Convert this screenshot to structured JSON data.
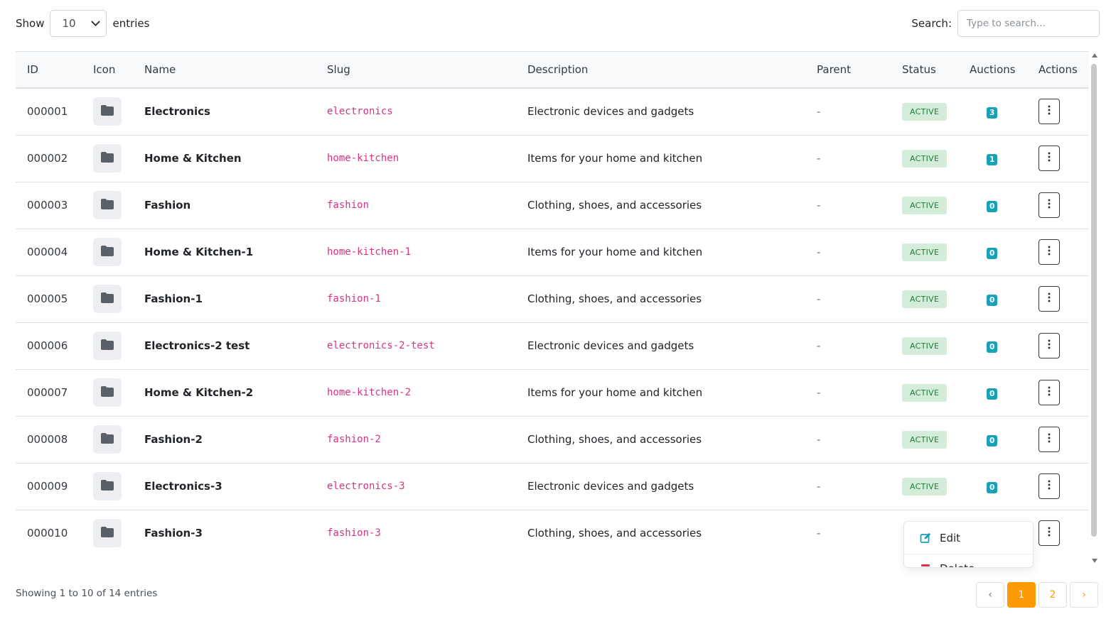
{
  "controls": {
    "show_label": "Show",
    "entries_value": "10",
    "entries_label": "entries",
    "search_label": "Search:",
    "search_placeholder": "Type to search...",
    "search_value": ""
  },
  "table": {
    "columns": [
      "ID",
      "Icon",
      "Name",
      "Slug",
      "Description",
      "Parent",
      "Status",
      "Auctions",
      "Actions"
    ],
    "rows": [
      {
        "id": "000001",
        "icon": "folder-icon",
        "name": "Electronics",
        "slug": "electronics",
        "description": "Electronic devices and gadgets",
        "parent": "-",
        "status": "ACTIVE",
        "auctions": "3"
      },
      {
        "id": "000002",
        "icon": "folder-icon",
        "name": "Home & Kitchen",
        "slug": "home-kitchen",
        "description": "Items for your home and kitchen",
        "parent": "-",
        "status": "ACTIVE",
        "auctions": "1"
      },
      {
        "id": "000003",
        "icon": "folder-icon",
        "name": "Fashion",
        "slug": "fashion",
        "description": "Clothing, shoes, and accessories",
        "parent": "-",
        "status": "ACTIVE",
        "auctions": "0"
      },
      {
        "id": "000004",
        "icon": "folder-icon",
        "name": "Home & Kitchen-1",
        "slug": "home-kitchen-1",
        "description": "Items for your home and kitchen",
        "parent": "-",
        "status": "ACTIVE",
        "auctions": "0"
      },
      {
        "id": "000005",
        "icon": "folder-icon",
        "name": "Fashion-1",
        "slug": "fashion-1",
        "description": "Clothing, shoes, and accessories",
        "parent": "-",
        "status": "ACTIVE",
        "auctions": "0"
      },
      {
        "id": "000006",
        "icon": "folder-icon",
        "name": "Electronics-2 test",
        "slug": "electronics-2-test",
        "description": "Electronic devices and gadgets",
        "parent": "-",
        "status": "ACTIVE",
        "auctions": "0"
      },
      {
        "id": "000007",
        "icon": "folder-icon",
        "name": "Home & Kitchen-2",
        "slug": "home-kitchen-2",
        "description": "Items for your home and kitchen",
        "parent": "-",
        "status": "ACTIVE",
        "auctions": "0"
      },
      {
        "id": "000008",
        "icon": "folder-icon",
        "name": "Fashion-2",
        "slug": "fashion-2",
        "description": "Clothing, shoes, and accessories",
        "parent": "-",
        "status": "ACTIVE",
        "auctions": "0"
      },
      {
        "id": "000009",
        "icon": "folder-icon",
        "name": "Electronics-3",
        "slug": "electronics-3",
        "description": "Electronic devices and gadgets",
        "parent": "-",
        "status": "ACTIVE",
        "auctions": "0"
      },
      {
        "id": "000010",
        "icon": "folder-icon",
        "name": "Fashion-3",
        "slug": "fashion-3",
        "description": "Clothing, shoes, and accessories",
        "parent": "-",
        "status": "",
        "auctions": ""
      }
    ]
  },
  "dropdown": {
    "edit_label": "Edit",
    "edit_icon": "edit-icon",
    "delete_label": "Delete",
    "delete_icon": "trash-icon"
  },
  "footer": {
    "info": "Showing 1 to 10 of 14 entries",
    "prev": "‹",
    "pages": [
      "1",
      "2"
    ],
    "current_page": "1",
    "next": "›"
  },
  "colors": {
    "accent": "#fd9a08",
    "badge": "#17a2b8",
    "status_bg": "#d4eddb",
    "status_text": "#1e7e34",
    "slug": "#d63384",
    "edit_icon": "#17a2b8",
    "delete_icon": "#dc3545"
  }
}
